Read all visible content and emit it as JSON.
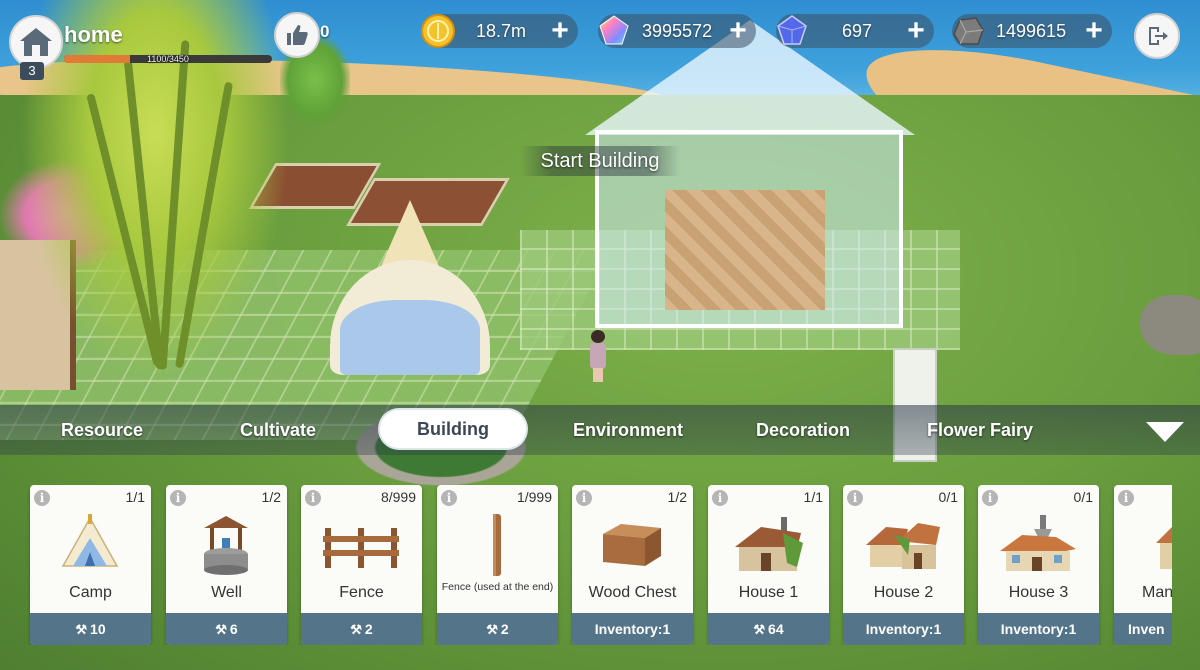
{
  "hud": {
    "home_title": "home",
    "level": "3",
    "xp_text": "1100/3450",
    "xp_progress": 0.319,
    "likes": "0",
    "resources": [
      {
        "name": "gold-coin",
        "value": "18.7m",
        "color": "#f2b01c"
      },
      {
        "name": "rainbow-crystal",
        "value": "3995572",
        "color": "#c86be0"
      },
      {
        "name": "blue-crystal",
        "value": "697",
        "color": "#5b6ee8"
      },
      {
        "name": "ore",
        "value": "1499615",
        "color": "#7a7a7a"
      }
    ]
  },
  "scene": {
    "start_building": "Start Building"
  },
  "tabs": [
    {
      "label": "Resource",
      "active": false
    },
    {
      "label": "Cultivate",
      "active": false
    },
    {
      "label": "Building",
      "active": true
    },
    {
      "label": "Environment",
      "active": false
    },
    {
      "label": "Decoration",
      "active": false
    },
    {
      "label": "Flower Fairy",
      "active": false
    }
  ],
  "cards": [
    {
      "name": "Camp",
      "count": "1/1",
      "foot": "10",
      "foot_type": "cost",
      "icon": "camp-icon"
    },
    {
      "name": "Well",
      "count": "1/2",
      "foot": "6",
      "foot_type": "cost",
      "icon": "well-icon"
    },
    {
      "name": "Fence",
      "count": "8/999",
      "foot": "2",
      "foot_type": "cost",
      "icon": "fence-icon"
    },
    {
      "name": "Fence (used at the end)",
      "count": "1/999",
      "foot": "2",
      "foot_type": "cost",
      "icon": "fence-post-icon"
    },
    {
      "name": "Wood Chest",
      "count": "1/2",
      "foot": "Inventory:1",
      "foot_type": "inventory",
      "icon": "wood-chest-icon"
    },
    {
      "name": "House 1",
      "count": "1/1",
      "foot": "64",
      "foot_type": "cost",
      "icon": "house-1-icon"
    },
    {
      "name": "House 2",
      "count": "0/1",
      "foot": "Inventory:1",
      "foot_type": "inventory",
      "icon": "house-2-icon"
    },
    {
      "name": "House 3",
      "count": "0/1",
      "foot": "Inventory:1",
      "foot_type": "inventory",
      "icon": "house-3-icon"
    },
    {
      "name": "Man",
      "count": "",
      "foot": "Inven",
      "foot_type": "inventory",
      "icon": "manor-icon"
    }
  ]
}
